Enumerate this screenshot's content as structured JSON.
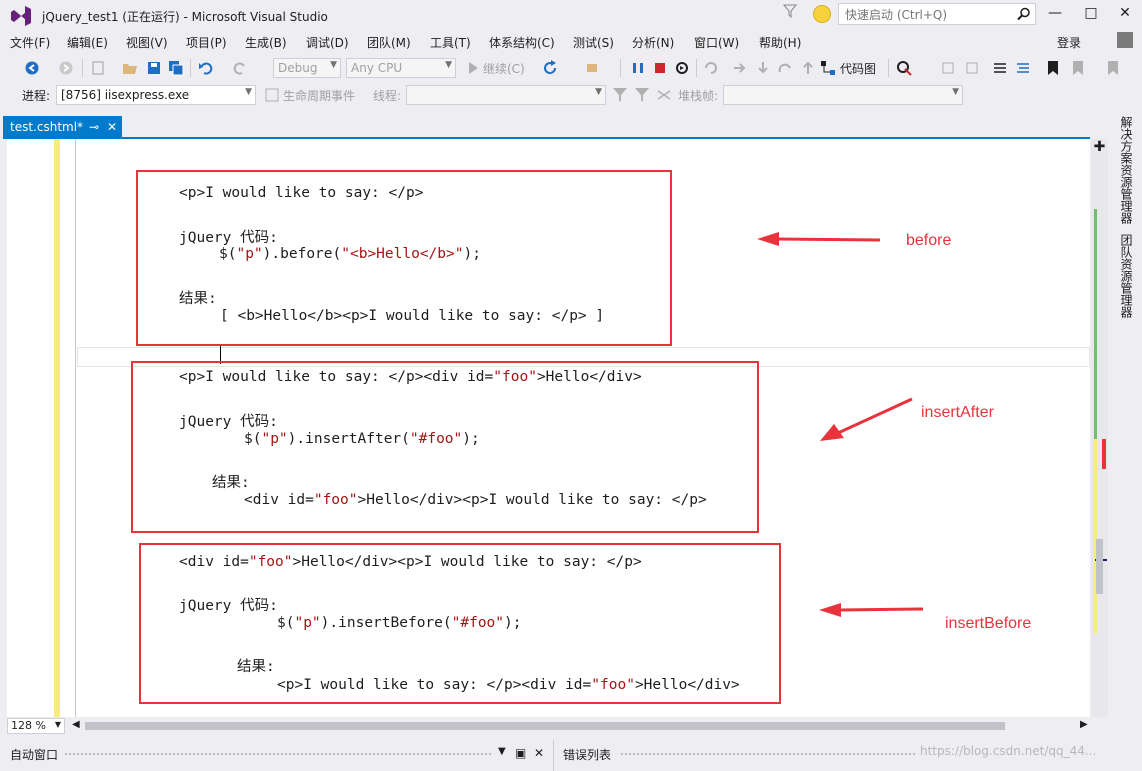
{
  "window": {
    "title": "jQuery_test1 (正在运行) - Microsoft Visual Studio",
    "quick_launch_placeholder": "快速启动 (Ctrl+Q)",
    "login": "登录"
  },
  "menu": [
    "文件(F)",
    "编辑(E)",
    "视图(V)",
    "项目(P)",
    "生成(B)",
    "调试(D)",
    "团队(M)",
    "工具(T)",
    "体系结构(C)",
    "测试(S)",
    "分析(N)",
    "窗口(W)",
    "帮助(H)"
  ],
  "toolbar": {
    "config": "Debug",
    "platform": "Any CPU",
    "continue_label": "继续(C)",
    "codemap_label": "代码图",
    "process_label": "进程:",
    "process_value": "[8756] iisexpress.exe",
    "lifecycle_label": "生命周期事件",
    "thread_label": "线程:",
    "stackframe_label": "堆栈帧:"
  },
  "tab": {
    "label": "test.cshtml*",
    "pin": "⊸",
    "close": "✕"
  },
  "code": {
    "block1": {
      "l1": "<p>I would like to say: </p>",
      "l2_label": "jQuery 代码:",
      "l3_pre": "$(",
      "l3_str1": "\"p\"",
      "l3_mid": ").before(",
      "l3_str2": "\"<b>Hello</b>\"",
      "l3_end": ");",
      "l4_label": "结果:",
      "l5": "[ <b>Hello</b><p>I would like to say: </p> ]"
    },
    "block2": {
      "l1_pre": "<p>I would like to say: </p><div id=",
      "l1_str": "\"foo\"",
      "l1_end": ">Hello</div>",
      "l2_label": "jQuery 代码:",
      "l3_pre": "$(",
      "l3_str1": "\"p\"",
      "l3_mid": ").insertAfter(",
      "l3_str2": "\"#foo\"",
      "l3_end": ");",
      "l4_label": "结果:",
      "l5_pre": "<div id=",
      "l5_str": "\"foo\"",
      "l5_end": ">Hello</div><p>I would like to say: </p>"
    },
    "block3": {
      "l1_pre": "<div id=",
      "l1_str": "\"foo\"",
      "l1_end": ">Hello</div><p>I would like to say: </p>",
      "l2_label": "jQuery 代码:",
      "l3_pre": "$(",
      "l3_str1": "\"p\"",
      "l3_mid": ").insertBefore(",
      "l3_str2": "\"#foo\"",
      "l3_end": ");",
      "l4_label": "结果:",
      "l5_pre": "<p>I would like to say: </p><div id=",
      "l5_str": "\"foo\"",
      "l5_end": ">Hello</div>"
    }
  },
  "annotations": {
    "before": "before",
    "insertAfter": "insertAfter",
    "insertBefore": "insertBefore",
    "color": "#e8333c"
  },
  "side_panel": {
    "solution_explorer": "解决方案资源管理器",
    "team_explorer": "团队资源管理器"
  },
  "zoom": "128 %",
  "bottom": {
    "auto_window": "自动窗口",
    "error_list": "错误列表",
    "watermark": "https://blog.csdn.net/qq_44..."
  },
  "colors": {
    "accent": "#007acc",
    "string": "#a31515",
    "annotation": "#e8333c"
  }
}
